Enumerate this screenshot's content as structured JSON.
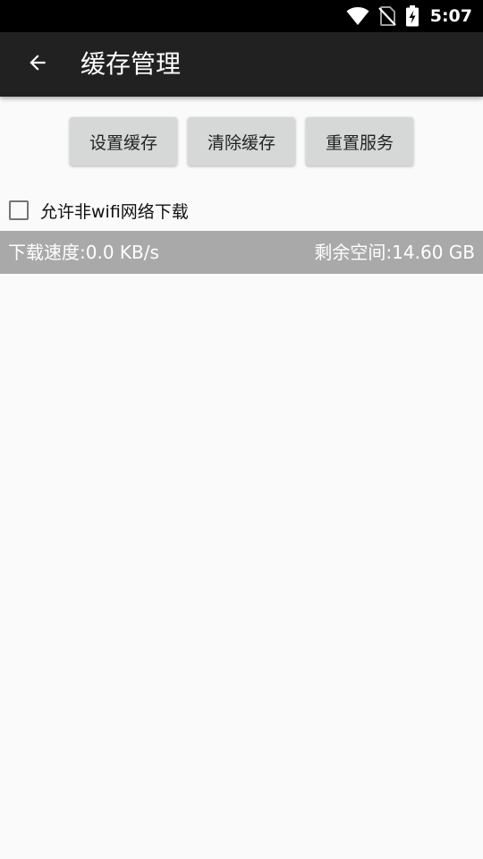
{
  "status_bar": {
    "time": "5:07",
    "icons": [
      "wifi-icon",
      "no-sim-icon",
      "battery-charging-icon"
    ]
  },
  "app_bar": {
    "title": "缓存管理",
    "back_icon": "arrow-left-icon"
  },
  "buttons": [
    {
      "label": "设置缓存"
    },
    {
      "label": "清除缓存"
    },
    {
      "label": "重置服务"
    }
  ],
  "options": {
    "allow_non_wifi_label": "允许非wifi网络下载",
    "allow_non_wifi_checked": false
  },
  "info_bar": {
    "download_speed": "下载速度:0.0 KB/s",
    "free_space": "剩余空间:14.60 GB"
  },
  "colors": {
    "status_bar": "#000000",
    "app_bar": "#212121",
    "background": "#fafafa",
    "button": "#d6d7d7",
    "info_bar": "#a9a9a9"
  }
}
